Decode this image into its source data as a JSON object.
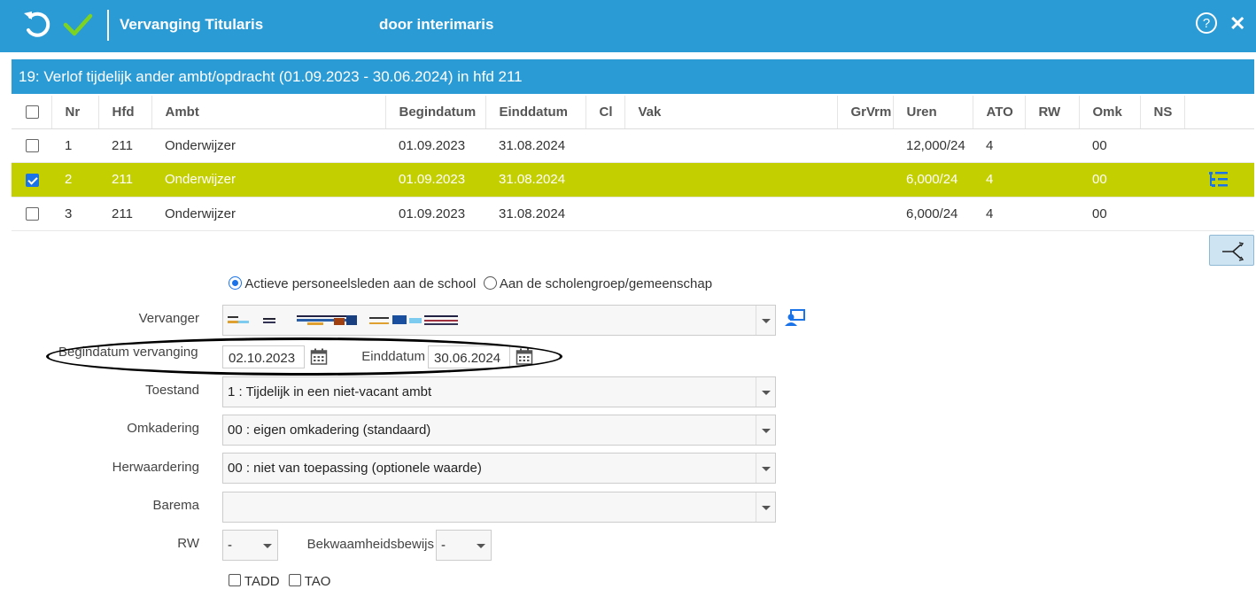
{
  "header": {
    "title": "Vervanging Titularis",
    "subtitle": "door interimaris",
    "close_symbol": "✕",
    "undo_icon": "undo-icon",
    "confirm_icon": "check-icon",
    "help_icon": "help-icon"
  },
  "section": {
    "title": "19: Verlof tijdelijk ander ambt/opdracht (01.09.2023 - 30.06.2024) in hfd 211"
  },
  "table": {
    "columns": [
      "Nr",
      "Hfd",
      "Ambt",
      "Begindatum",
      "Einddatum",
      "Cl",
      "Vak",
      "GrVrm",
      "Uren",
      "ATO",
      "RW",
      "Omk",
      "NS"
    ],
    "rows": [
      {
        "checked": false,
        "nr": "1",
        "hfd": "211",
        "ambt": "Onderwijzer",
        "begindatum": "01.09.2023",
        "einddatum": "31.08.2024",
        "cl": "",
        "vak": "",
        "grvrm": "",
        "uren": "12,000/24",
        "ato": "4",
        "rw": "",
        "omk": "00",
        "ns": ""
      },
      {
        "checked": true,
        "nr": "2",
        "hfd": "211",
        "ambt": "Onderwijzer",
        "begindatum": "01.09.2023",
        "einddatum": "31.08.2024",
        "cl": "",
        "vak": "",
        "grvrm": "",
        "uren": "6,000/24",
        "ato": "4",
        "rw": "",
        "omk": "00",
        "ns": ""
      },
      {
        "checked": false,
        "nr": "3",
        "hfd": "211",
        "ambt": "Onderwijzer",
        "begindatum": "01.09.2023",
        "einddatum": "31.08.2024",
        "cl": "",
        "vak": "",
        "grvrm": "",
        "uren": "6,000/24",
        "ato": "4",
        "rw": "",
        "omk": "00",
        "ns": ""
      }
    ],
    "selected_row_color": "#c4cf00"
  },
  "form": {
    "radio_active": "Actieve personeelsleden aan de school",
    "radio_group": "Aan de scholengroep/gemeenschap",
    "vervanger_label": "Vervanger",
    "vervanger_value": "",
    "begindatum_label": "Begindatum vervanging",
    "begindatum_value": "02.10.2023",
    "einddatum_label": "Einddatum",
    "einddatum_value": "30.06.2024",
    "toestand_label": "Toestand",
    "toestand_value": "1 : Tijdelijk in een niet-vacant ambt",
    "omkadering_label": "Omkadering",
    "omkadering_value": "00 : eigen omkadering (standaard)",
    "herwaardering_label": "Herwaardering",
    "herwaardering_value": "00 : niet van toepassing (optionele waarde)",
    "barema_label": "Barema",
    "barema_value": "",
    "rw_label": "RW",
    "rw_value": "-",
    "bekwaamheid_label": "Bekwaamheidsbewijs",
    "bekwaamheid_value": "-",
    "tadd_label": "TADD",
    "tao_label": "TAO"
  },
  "colors": {
    "header_bg": "#2b9bd6",
    "accent_blue": "#1a73e8",
    "confirm_green": "#7ed321"
  }
}
